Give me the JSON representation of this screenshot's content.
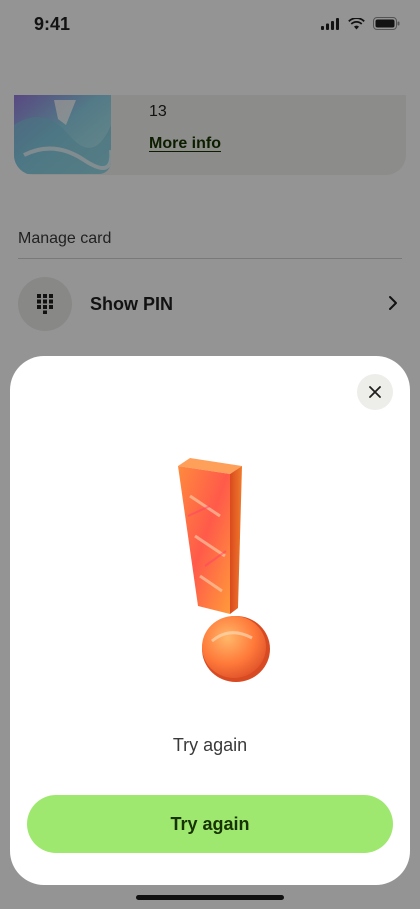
{
  "status_bar": {
    "time": "9:41"
  },
  "card": {
    "number_fragment": "13",
    "more_info_label": "More info"
  },
  "manage": {
    "title": "Manage card",
    "show_pin_label": "Show PIN"
  },
  "sheet": {
    "message": "Try again",
    "button_label": "Try again"
  },
  "colors": {
    "brand_green": "#9fe870",
    "brand_text": "#163300",
    "overlay": "rgba(0,0,0,0.42)"
  },
  "icons": [
    "signal-icon",
    "wifi-icon",
    "battery-icon",
    "keypad-icon",
    "chevron-right-icon",
    "close-icon",
    "exclamation-illustration"
  ]
}
